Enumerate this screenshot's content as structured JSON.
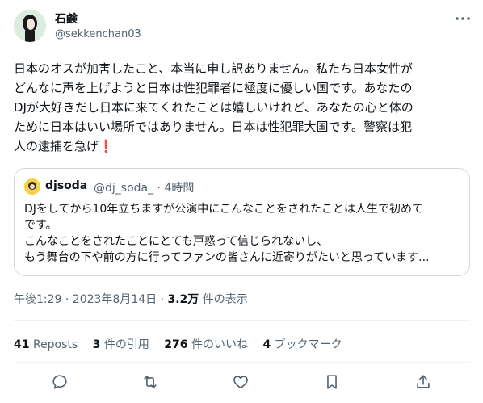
{
  "author": {
    "name": "石鹸",
    "handle": "@sekkenchan03"
  },
  "tweet": {
    "text": "日本のオスが加害したこと、本当に申し訳ありません。私たち日本女性が\nどんなに声を上げようと日本は性犯罪者に極度に優しい国です。あなたの\nDJが大好きだし日本に来てくれたことは嬉しいけれど、あなたの心と体の\nために日本はいい場所ではありません。日本は性犯罪大国です。警察は犯\n人の逮捕を急げ",
    "emoji": "❗"
  },
  "quoted": {
    "name": "djsoda",
    "handle_time": "@dj_soda_ · 4時間",
    "text": "DJをしてから10年立ちますが公演中にこんなことをされたことは人生で初めて\nです。\nこんなことをされたことにとても戸惑って信じられないし、\nもう舞台の下や前の方に行ってファンの皆さんに近寄りがたいと思っています..."
  },
  "meta": {
    "timestamp": "午後1:29 · 2023年8月14日 · ",
    "views_count": "3.2万",
    "views_label": " 件の表示"
  },
  "stats": [
    {
      "count": "41",
      "label": "Reposts"
    },
    {
      "count": "3",
      "label": "件の引用"
    },
    {
      "count": "276",
      "label": "件のいいね"
    },
    {
      "count": "4",
      "label": "ブックマーク"
    }
  ],
  "colors": {
    "text": "#0f1419",
    "secondary": "#536471",
    "border": "#cfd9de",
    "alarm": "#e0245e"
  },
  "icons": [
    "more-icon",
    "reply-icon",
    "repost-icon",
    "like-icon",
    "bookmark-icon",
    "share-icon"
  ]
}
